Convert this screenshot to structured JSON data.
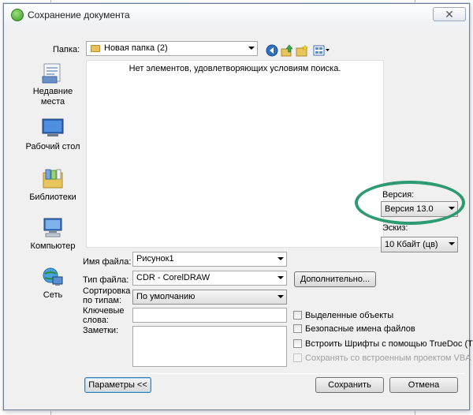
{
  "window": {
    "title": "Сохранение документа",
    "close_glyph": "✕"
  },
  "toolbar": {
    "folder_label": "Папка:",
    "folder_value": "Новая папка (2)",
    "icons": [
      "back-icon",
      "up-folder-icon",
      "new-folder-icon",
      "view-menu-icon"
    ]
  },
  "places": [
    {
      "label": "Недавние места",
      "icon": "recent-places-icon"
    },
    {
      "label": "Рабочий стол",
      "icon": "desktop-icon"
    },
    {
      "label": "Библиотеки",
      "icon": "libraries-icon"
    },
    {
      "label": "Компьютер",
      "icon": "computer-icon"
    },
    {
      "label": "Сеть",
      "icon": "network-icon"
    }
  ],
  "file_list": {
    "empty_message": "Нет элементов, удовлетворяющих условиям поиска."
  },
  "form": {
    "filename_label": "Имя файла:",
    "filename_value": "Рисунок1",
    "filetype_label": "Тип файла:",
    "filetype_value": "CDR - CorelDRAW",
    "sort_label": "Сортировка по типам:",
    "sort_value": "По умолчанию",
    "keywords_label": "Ключевые слова:",
    "keywords_value": "",
    "notes_label": "Заметки:",
    "notes_value": ""
  },
  "right_panel": {
    "version_label": "Версия:",
    "version_value": "Версия 13.0",
    "sketch_label": "Эскиз:",
    "sketch_value": "10 Кбайт (цв)",
    "advanced_button": "Дополнительно..."
  },
  "checkboxes": [
    {
      "label": "Выделенные объекты",
      "checked": false,
      "disabled": false
    },
    {
      "label": "Безопасные имена файлов",
      "checked": false,
      "disabled": false
    },
    {
      "label": "Встроить Шрифты с помощью TrueDoc (TM)",
      "checked": false,
      "disabled": false
    },
    {
      "label": "Сохранять со встроенным проектом VBA",
      "checked": false,
      "disabled": true
    }
  ],
  "buttons": {
    "params": "Параметры <<",
    "save": "Сохранить",
    "cancel": "Отмена"
  },
  "colors": {
    "highlight_ellipse": "#2e9a71",
    "window_bg": "#f0f0f0"
  }
}
